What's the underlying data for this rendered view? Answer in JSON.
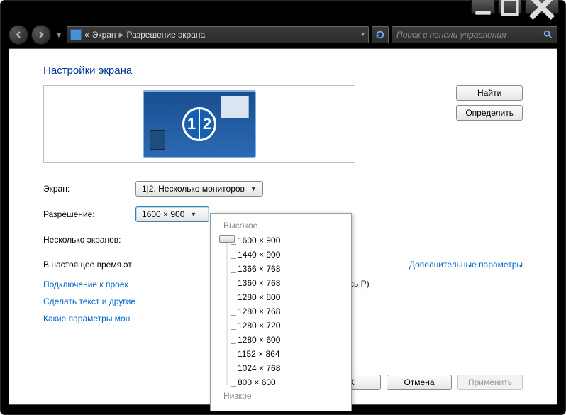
{
  "breadcrumb": {
    "prefix": "«",
    "item1": "Экран",
    "item2": "Разрешение экрана"
  },
  "search": {
    "placeholder": "Поиск в панели управления"
  },
  "heading": "Настройки экрана",
  "monitor": {
    "n1": "1",
    "n2": "2"
  },
  "buttons": {
    "find": "Найти",
    "identify": "Определить",
    "ok": "OK",
    "cancel": "Отмена",
    "apply": "Применить"
  },
  "labels": {
    "screen": "Экран:",
    "resolution": "Разрешение:",
    "multi": "Несколько экранов:"
  },
  "screen_combo": "1|2. Несколько мониторов",
  "resolution_value": "1600 × 900",
  "status_prefix": "В настоящее время эт",
  "adv_link": "Дополнительные параметры",
  "link_projector_a": "Подключение к проек",
  "link_projector_b": "оснитесь P)",
  "link_text": "Сделать текст и другие",
  "link_which": "Какие параметры мон",
  "popup": {
    "high": "Высокое",
    "low": "Низкое",
    "options": [
      "1600 × 900",
      "1440 × 900",
      "1366 × 768",
      "1360 × 768",
      "1280 × 800",
      "1280 × 768",
      "1280 × 720",
      "1280 × 600",
      "1152 × 864",
      "1024 × 768",
      "800 × 600"
    ]
  }
}
